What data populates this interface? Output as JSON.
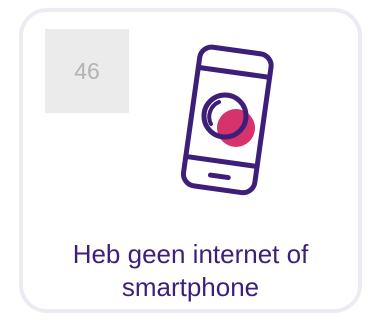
{
  "card": {
    "number": "46",
    "caption_line1": "Heb geen internet of",
    "caption_line2": "smartphone",
    "icon": "smartphone-icon"
  },
  "colors": {
    "border": "#ecebf3",
    "badge_bg": "#ebebeb",
    "badge_text": "#b3b3b3",
    "text_primary": "#3d1f7a",
    "accent": "#d6336c"
  }
}
